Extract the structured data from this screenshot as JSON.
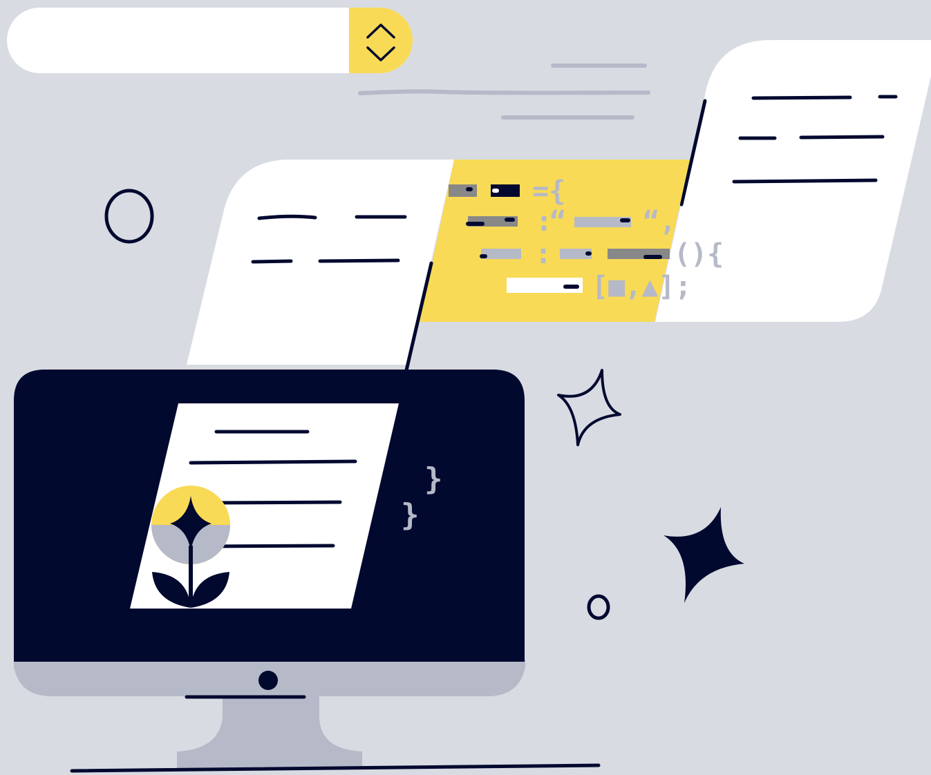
{
  "select": {
    "value": "",
    "icon": "chevron-up-down-icon"
  },
  "colors": {
    "background": "#d8dbe2",
    "navy": "#02092f",
    "yellow": "#f8da56",
    "white": "#ffffff",
    "gray": "#b6b9c7",
    "dark_gray": "#888888"
  },
  "code_snippet": {
    "line1_operator": "={",
    "line2_colon": ":",
    "line2_open_quote": "“",
    "line2_close_quote": "“,",
    "line3_colon": ":",
    "line3_call": "(){",
    "line4_array": "[■,▲];"
  },
  "screen_braces": [
    "}",
    "}"
  ],
  "icons": {
    "plant": "plant-icon",
    "circle_large": "circle-outline-icon",
    "circle_small": "circle-outline-small-icon",
    "sparkle_outline": "sparkle-outline-icon",
    "sparkle_filled": "sparkle-filled-icon",
    "monitor": "desktop-monitor-icon"
  }
}
